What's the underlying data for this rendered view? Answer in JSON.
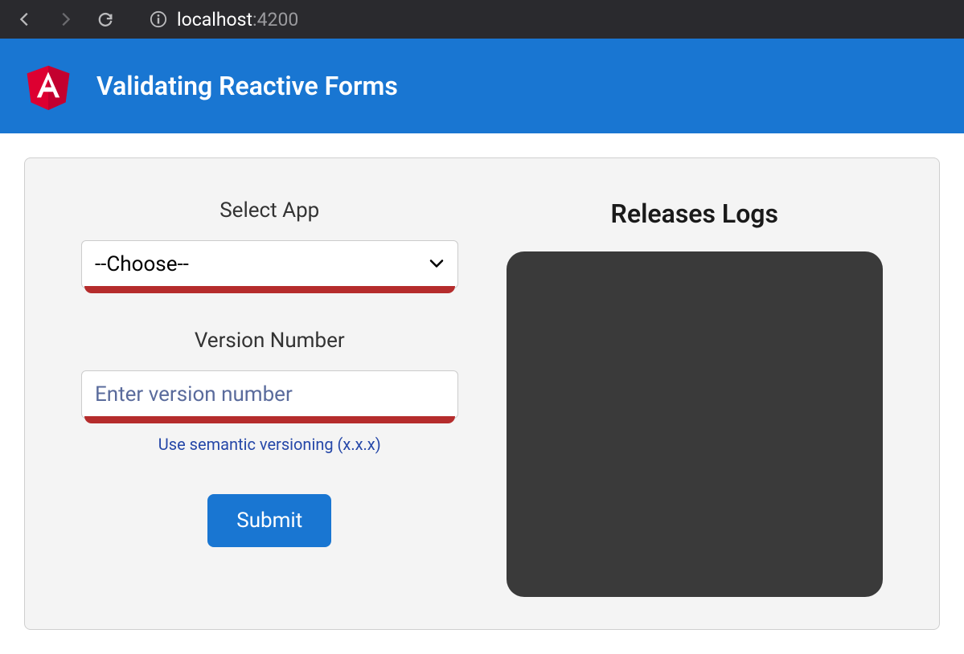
{
  "browser": {
    "url_host": "localhost",
    "url_port": ":4200"
  },
  "header": {
    "title": "Validating Reactive Forms"
  },
  "form": {
    "app_label": "Select App",
    "app_placeholder": "--Choose--",
    "version_label": "Version Number",
    "version_placeholder": "Enter version number",
    "version_hint": "Use semantic versioning (x.x.x)",
    "submit_label": "Submit"
  },
  "logs": {
    "title": "Releases Logs"
  }
}
